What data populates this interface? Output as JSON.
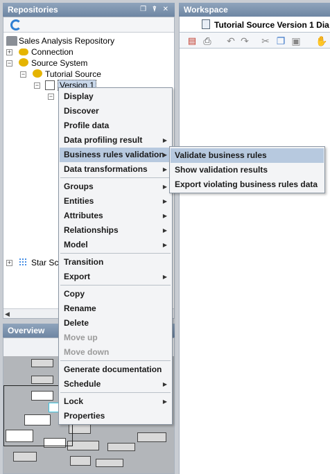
{
  "repositories": {
    "title": "Repositories",
    "window_controls": "❐ ⍒ ✕",
    "tree": {
      "root": "Sales Analysis Repository",
      "connection": "Connection",
      "source_system": "Source System",
      "tutorial_source": "Tutorial Source",
      "version": "Version 1",
      "star_schema": "Star Sc"
    }
  },
  "workspace": {
    "title": "Workspace",
    "tab_label": "Tutorial Source Version 1 Dia"
  },
  "overview": {
    "title": "Overview"
  },
  "context_menu": {
    "items": [
      {
        "label": "Display"
      },
      {
        "label": "Discover"
      },
      {
        "label": "Profile data"
      },
      {
        "label": "Data profiling result"
      },
      {
        "label": "Business rules validation"
      },
      {
        "label": "Data transformations"
      },
      {
        "label": "Groups"
      },
      {
        "label": "Entities"
      },
      {
        "label": "Attributes"
      },
      {
        "label": "Relationships"
      },
      {
        "label": "Model"
      },
      {
        "label": "Transition"
      },
      {
        "label": "Export"
      },
      {
        "label": "Copy"
      },
      {
        "label": "Rename"
      },
      {
        "label": "Delete"
      },
      {
        "label": "Move up"
      },
      {
        "label": "Move down"
      },
      {
        "label": "Generate documentation"
      },
      {
        "label": "Schedule"
      },
      {
        "label": "Lock"
      },
      {
        "label": "Properties"
      }
    ]
  },
  "submenu": {
    "items": [
      {
        "label": "Validate business rules"
      },
      {
        "label": "Show validation results"
      },
      {
        "label": "Export violating business rules data"
      }
    ]
  },
  "colors": {
    "title_bar": "#7b91ad",
    "menu_highlight": "#b7c9df",
    "menu_background": "#f3f4f6"
  },
  "arrow_glyph": "▶"
}
